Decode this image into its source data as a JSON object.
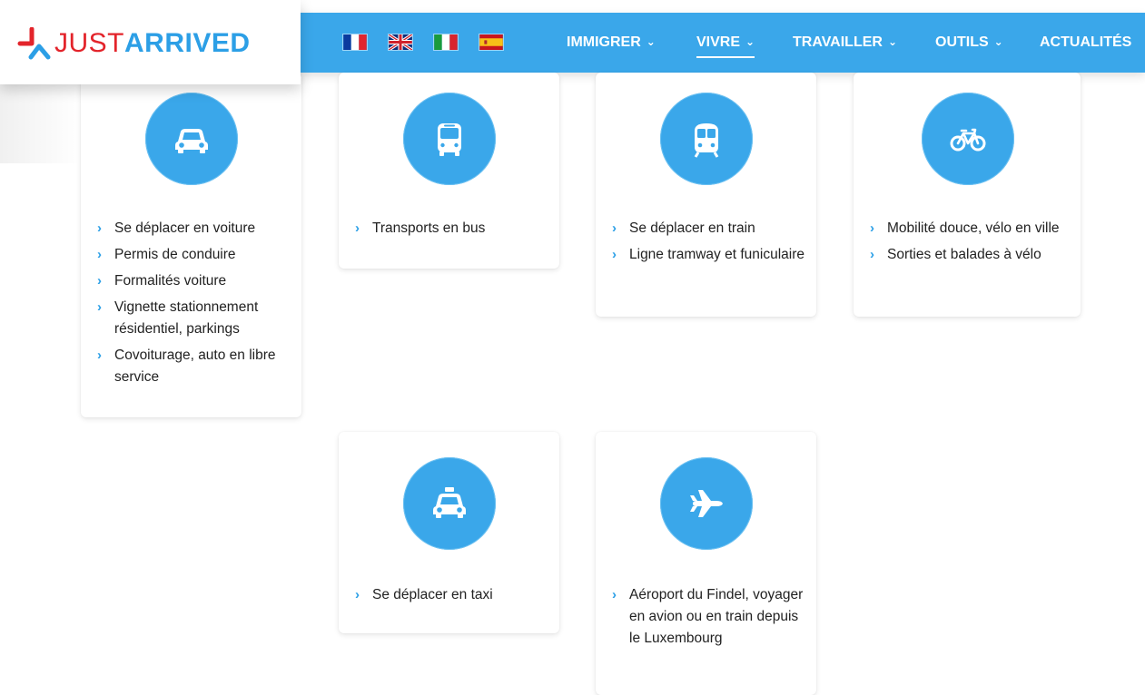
{
  "brand": {
    "just": "JUST",
    "arrived": "ARRIVED"
  },
  "languages": [
    {
      "code": "fr",
      "icon": "flag-france-icon"
    },
    {
      "code": "en",
      "icon": "flag-uk-icon"
    },
    {
      "code": "it",
      "icon": "flag-italy-icon"
    },
    {
      "code": "es",
      "icon": "flag-spain-icon"
    }
  ],
  "nav": {
    "immigrer": "IMMIGRER",
    "vivre": "VIVRE",
    "travailler": "TRAVAILLER",
    "outils": "OUTILS",
    "actualites": "ACTUALITÉS",
    "chevron": "⌄"
  },
  "colors": {
    "accent": "#3aa7ea",
    "brand_red": "#e3242b",
    "brand_blue": "#2c9fe6"
  },
  "cards": [
    {
      "icon": "car-icon",
      "links": [
        "Se déplacer en voiture",
        "Permis de conduire",
        "Formalités voiture",
        "Vignette stationnement résidentiel, parkings",
        "Covoiturage, auto en libre service"
      ]
    },
    {
      "icon": "bus-icon",
      "links": [
        "Transports en bus"
      ]
    },
    {
      "icon": "train-icon",
      "links": [
        "Se déplacer en train",
        "Ligne tramway et funiculaire"
      ]
    },
    {
      "icon": "bicycle-icon",
      "links": [
        "Mobilité douce, vélo en ville",
        "Sorties et balades à vélo"
      ]
    },
    {
      "icon": "taxi-icon",
      "links": [
        "Se déplacer en taxi"
      ]
    },
    {
      "icon": "airplane-icon",
      "links": [
        "Aéroport du Findel, voyager en avion ou en train depuis le Luxembourg"
      ]
    }
  ],
  "link_arrow": "›"
}
